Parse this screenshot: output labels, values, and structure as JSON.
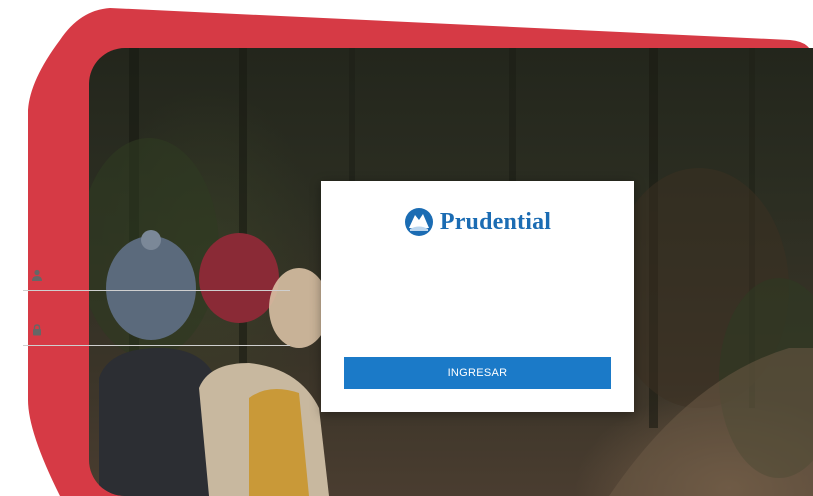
{
  "brand": {
    "name": "Prudential",
    "logo_icon": "prudential-rock-icon",
    "color": "#1b6cb3"
  },
  "login": {
    "username": {
      "icon": "user-icon",
      "value": "",
      "placeholder": ""
    },
    "password": {
      "icon": "lock-icon",
      "value": "",
      "placeholder": ""
    },
    "submit_label": "INGRESAR"
  },
  "colors": {
    "accent_red": "#d63a45",
    "button_blue": "#1b7ac8"
  }
}
